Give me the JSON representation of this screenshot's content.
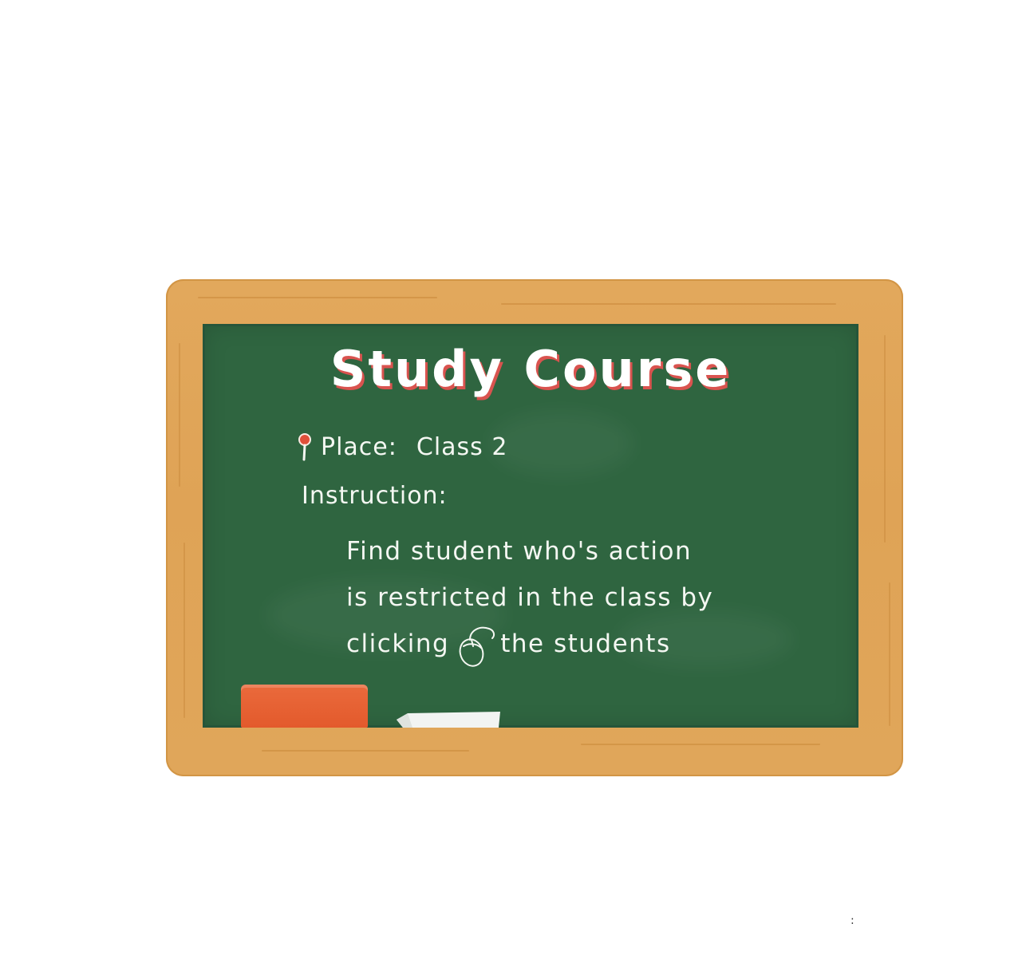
{
  "board": {
    "title": "Study Course",
    "place_label": "Place:",
    "place_value": "Class 2",
    "instruction_label": "Instruction:",
    "instruction_lines": [
      "Find student who's action",
      "is restricted in the class by",
      "clicking",
      "the students"
    ]
  },
  "icons": {
    "pin": "map-pin-icon",
    "mouse": "mouse-icon"
  },
  "colors": {
    "board_green": "#2f6540",
    "frame_wood": "#e0a65a",
    "title_shadow": "#d9534f",
    "chalk_white": "#f4f7f2",
    "eraser_orange": "#e35a2c"
  },
  "footer": {
    "mark": ":"
  }
}
